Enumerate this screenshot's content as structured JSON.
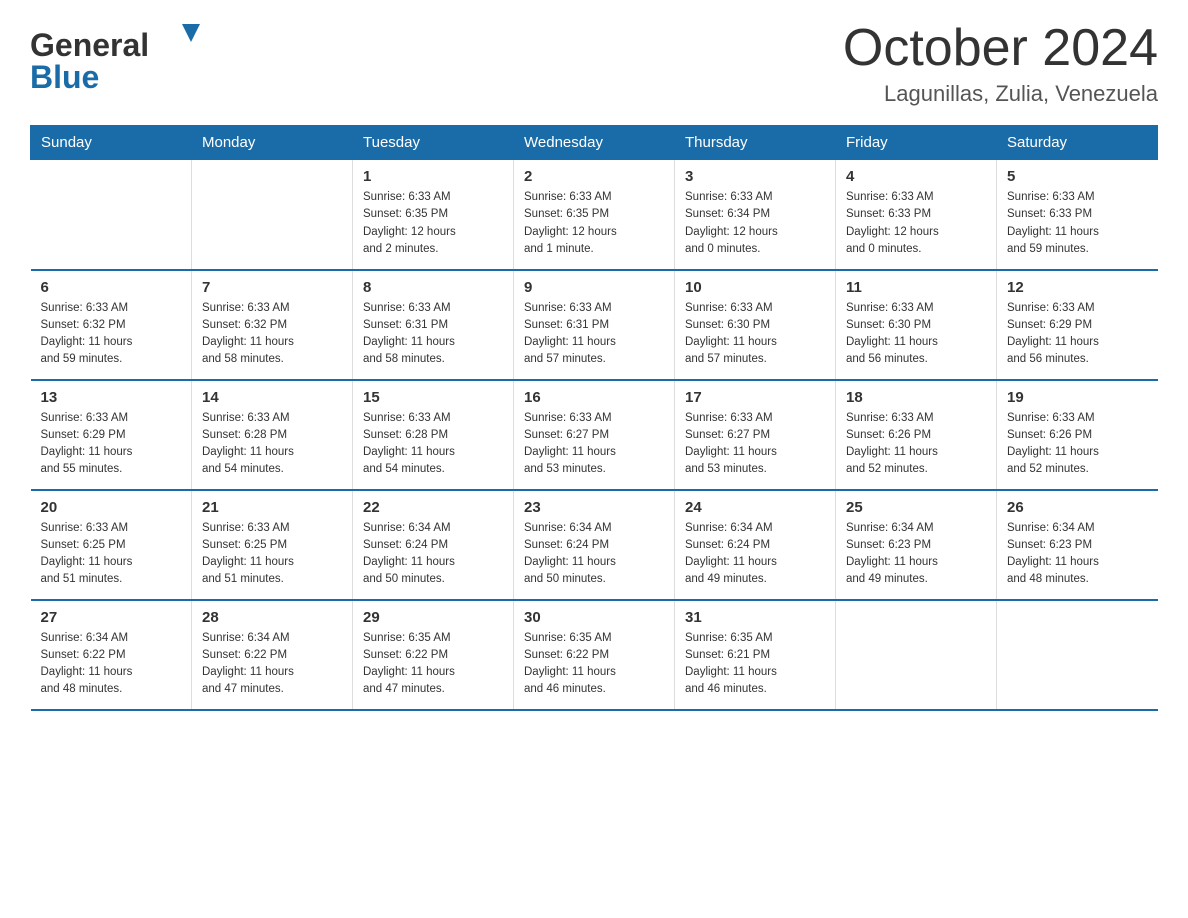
{
  "logo": {
    "text_general": "General",
    "text_blue": "Blue"
  },
  "header": {
    "month_year": "October 2024",
    "location": "Lagunillas, Zulia, Venezuela"
  },
  "weekdays": [
    "Sunday",
    "Monday",
    "Tuesday",
    "Wednesday",
    "Thursday",
    "Friday",
    "Saturday"
  ],
  "weeks": [
    [
      {
        "day": "",
        "info": ""
      },
      {
        "day": "",
        "info": ""
      },
      {
        "day": "1",
        "info": "Sunrise: 6:33 AM\nSunset: 6:35 PM\nDaylight: 12 hours\nand 2 minutes."
      },
      {
        "day": "2",
        "info": "Sunrise: 6:33 AM\nSunset: 6:35 PM\nDaylight: 12 hours\nand 1 minute."
      },
      {
        "day": "3",
        "info": "Sunrise: 6:33 AM\nSunset: 6:34 PM\nDaylight: 12 hours\nand 0 minutes."
      },
      {
        "day": "4",
        "info": "Sunrise: 6:33 AM\nSunset: 6:33 PM\nDaylight: 12 hours\nand 0 minutes."
      },
      {
        "day": "5",
        "info": "Sunrise: 6:33 AM\nSunset: 6:33 PM\nDaylight: 11 hours\nand 59 minutes."
      }
    ],
    [
      {
        "day": "6",
        "info": "Sunrise: 6:33 AM\nSunset: 6:32 PM\nDaylight: 11 hours\nand 59 minutes."
      },
      {
        "day": "7",
        "info": "Sunrise: 6:33 AM\nSunset: 6:32 PM\nDaylight: 11 hours\nand 58 minutes."
      },
      {
        "day": "8",
        "info": "Sunrise: 6:33 AM\nSunset: 6:31 PM\nDaylight: 11 hours\nand 58 minutes."
      },
      {
        "day": "9",
        "info": "Sunrise: 6:33 AM\nSunset: 6:31 PM\nDaylight: 11 hours\nand 57 minutes."
      },
      {
        "day": "10",
        "info": "Sunrise: 6:33 AM\nSunset: 6:30 PM\nDaylight: 11 hours\nand 57 minutes."
      },
      {
        "day": "11",
        "info": "Sunrise: 6:33 AM\nSunset: 6:30 PM\nDaylight: 11 hours\nand 56 minutes."
      },
      {
        "day": "12",
        "info": "Sunrise: 6:33 AM\nSunset: 6:29 PM\nDaylight: 11 hours\nand 56 minutes."
      }
    ],
    [
      {
        "day": "13",
        "info": "Sunrise: 6:33 AM\nSunset: 6:29 PM\nDaylight: 11 hours\nand 55 minutes."
      },
      {
        "day": "14",
        "info": "Sunrise: 6:33 AM\nSunset: 6:28 PM\nDaylight: 11 hours\nand 54 minutes."
      },
      {
        "day": "15",
        "info": "Sunrise: 6:33 AM\nSunset: 6:28 PM\nDaylight: 11 hours\nand 54 minutes."
      },
      {
        "day": "16",
        "info": "Sunrise: 6:33 AM\nSunset: 6:27 PM\nDaylight: 11 hours\nand 53 minutes."
      },
      {
        "day": "17",
        "info": "Sunrise: 6:33 AM\nSunset: 6:27 PM\nDaylight: 11 hours\nand 53 minutes."
      },
      {
        "day": "18",
        "info": "Sunrise: 6:33 AM\nSunset: 6:26 PM\nDaylight: 11 hours\nand 52 minutes."
      },
      {
        "day": "19",
        "info": "Sunrise: 6:33 AM\nSunset: 6:26 PM\nDaylight: 11 hours\nand 52 minutes."
      }
    ],
    [
      {
        "day": "20",
        "info": "Sunrise: 6:33 AM\nSunset: 6:25 PM\nDaylight: 11 hours\nand 51 minutes."
      },
      {
        "day": "21",
        "info": "Sunrise: 6:33 AM\nSunset: 6:25 PM\nDaylight: 11 hours\nand 51 minutes."
      },
      {
        "day": "22",
        "info": "Sunrise: 6:34 AM\nSunset: 6:24 PM\nDaylight: 11 hours\nand 50 minutes."
      },
      {
        "day": "23",
        "info": "Sunrise: 6:34 AM\nSunset: 6:24 PM\nDaylight: 11 hours\nand 50 minutes."
      },
      {
        "day": "24",
        "info": "Sunrise: 6:34 AM\nSunset: 6:24 PM\nDaylight: 11 hours\nand 49 minutes."
      },
      {
        "day": "25",
        "info": "Sunrise: 6:34 AM\nSunset: 6:23 PM\nDaylight: 11 hours\nand 49 minutes."
      },
      {
        "day": "26",
        "info": "Sunrise: 6:34 AM\nSunset: 6:23 PM\nDaylight: 11 hours\nand 48 minutes."
      }
    ],
    [
      {
        "day": "27",
        "info": "Sunrise: 6:34 AM\nSunset: 6:22 PM\nDaylight: 11 hours\nand 48 minutes."
      },
      {
        "day": "28",
        "info": "Sunrise: 6:34 AM\nSunset: 6:22 PM\nDaylight: 11 hours\nand 47 minutes."
      },
      {
        "day": "29",
        "info": "Sunrise: 6:35 AM\nSunset: 6:22 PM\nDaylight: 11 hours\nand 47 minutes."
      },
      {
        "day": "30",
        "info": "Sunrise: 6:35 AM\nSunset: 6:22 PM\nDaylight: 11 hours\nand 46 minutes."
      },
      {
        "day": "31",
        "info": "Sunrise: 6:35 AM\nSunset: 6:21 PM\nDaylight: 11 hours\nand 46 minutes."
      },
      {
        "day": "",
        "info": ""
      },
      {
        "day": "",
        "info": ""
      }
    ]
  ]
}
